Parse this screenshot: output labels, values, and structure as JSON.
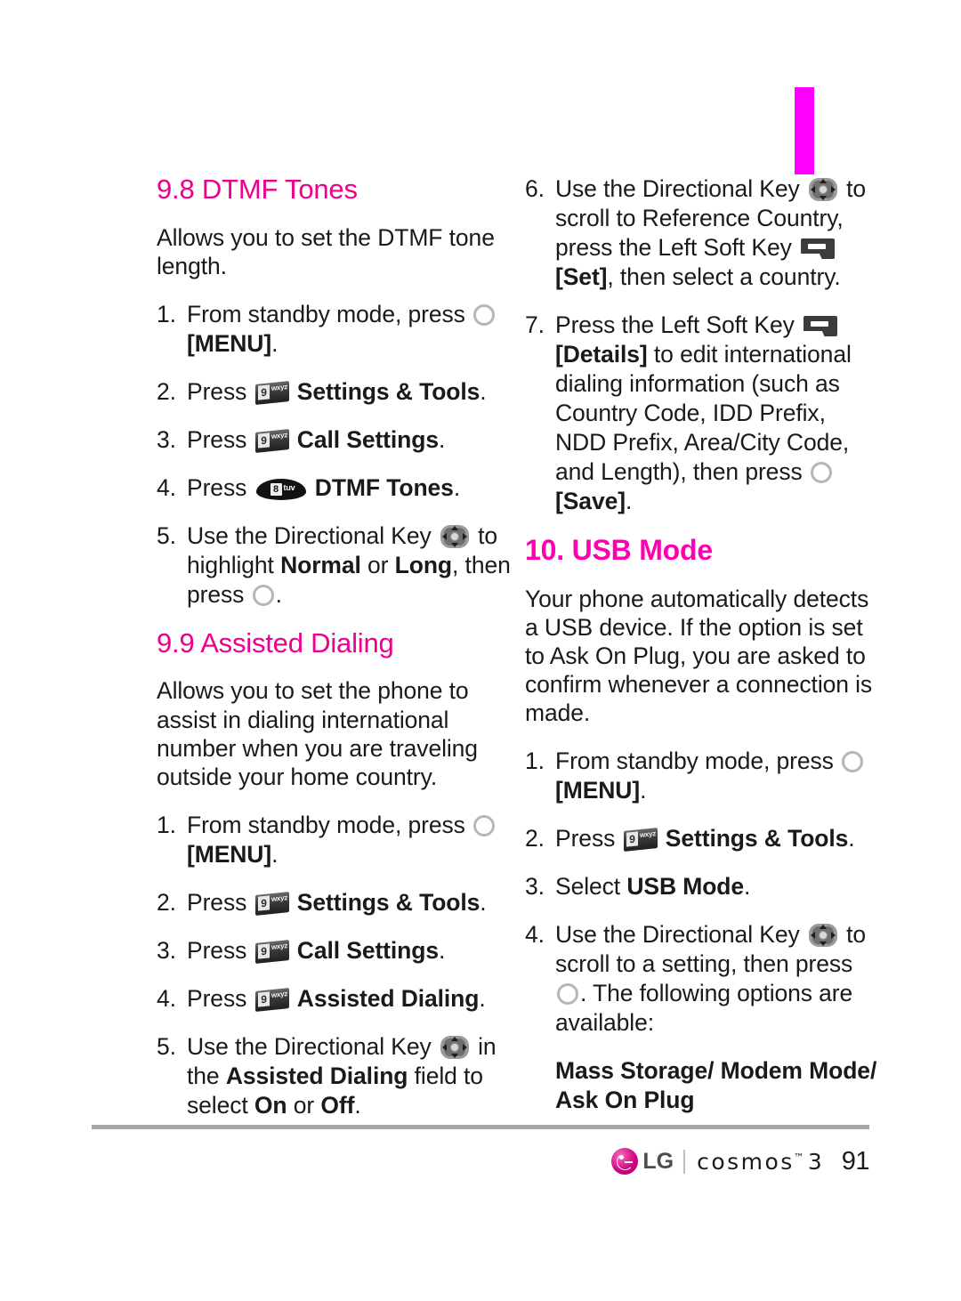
{
  "page": {
    "number": "91",
    "accent_color": "#ec008c",
    "tab_color": "#ff00ff"
  },
  "footer": {
    "brand": "LG",
    "product": "cosmos",
    "trademark": "™",
    "product_num": "3",
    "page_number": "91"
  },
  "left_column": {
    "section_1": {
      "heading": "9.8 DTMF Tones",
      "intro": "Allows you to set the DTMF tone length.",
      "steps": [
        {
          "num": "1.",
          "parts": [
            {
              "t": "text",
              "v": "From standby mode, press "
            },
            {
              "t": "icon",
              "v": "ok-button"
            },
            {
              "t": "text",
              "v": " "
            },
            {
              "t": "bold",
              "v": "[MENU]"
            },
            {
              "t": "text",
              "v": "."
            }
          ]
        },
        {
          "num": "2.",
          "parts": [
            {
              "t": "text",
              "v": "Press "
            },
            {
              "t": "icon",
              "v": "key-9-wxyz"
            },
            {
              "t": "text",
              "v": " "
            },
            {
              "t": "bold",
              "v": "Settings & Tools"
            },
            {
              "t": "text",
              "v": "."
            }
          ]
        },
        {
          "num": "3.",
          "parts": [
            {
              "t": "text",
              "v": "Press "
            },
            {
              "t": "icon",
              "v": "key-9-wxyz"
            },
            {
              "t": "text",
              "v": " "
            },
            {
              "t": "bold",
              "v": "Call Settings"
            },
            {
              "t": "text",
              "v": "."
            }
          ]
        },
        {
          "num": "4.",
          "parts": [
            {
              "t": "text",
              "v": "Press "
            },
            {
              "t": "icon",
              "v": "key-8-tuv"
            },
            {
              "t": "text",
              "v": " "
            },
            {
              "t": "bold",
              "v": "DTMF Tones"
            },
            {
              "t": "text",
              "v": "."
            }
          ]
        },
        {
          "num": "5.",
          "parts": [
            {
              "t": "text",
              "v": "Use the Directional Key "
            },
            {
              "t": "icon",
              "v": "directional-key"
            },
            {
              "t": "text",
              "v": " to highlight "
            },
            {
              "t": "bold",
              "v": "Normal"
            },
            {
              "t": "text",
              "v": " or "
            },
            {
              "t": "bold",
              "v": "Long"
            },
            {
              "t": "text",
              "v": ", then press "
            },
            {
              "t": "icon",
              "v": "ok-button"
            },
            {
              "t": "text",
              "v": "."
            }
          ]
        }
      ]
    },
    "section_2": {
      "heading": "9.9 Assisted Dialing",
      "intro": "Allows you to set the phone to assist in dialing international number when you are traveling outside your home country.",
      "steps": [
        {
          "num": "1.",
          "parts": [
            {
              "t": "text",
              "v": "From standby mode, press "
            },
            {
              "t": "icon",
              "v": "ok-button"
            },
            {
              "t": "text",
              "v": " "
            },
            {
              "t": "bold",
              "v": "[MENU]"
            },
            {
              "t": "text",
              "v": "."
            }
          ]
        },
        {
          "num": "2.",
          "parts": [
            {
              "t": "text",
              "v": "Press "
            },
            {
              "t": "icon",
              "v": "key-9-wxyz"
            },
            {
              "t": "text",
              "v": " "
            },
            {
              "t": "bold",
              "v": "Settings & Tools"
            },
            {
              "t": "text",
              "v": "."
            }
          ]
        },
        {
          "num": "3.",
          "parts": [
            {
              "t": "text",
              "v": "Press "
            },
            {
              "t": "icon",
              "v": "key-9-wxyz"
            },
            {
              "t": "text",
              "v": " "
            },
            {
              "t": "bold",
              "v": "Call Settings"
            },
            {
              "t": "text",
              "v": "."
            }
          ]
        },
        {
          "num": "4.",
          "parts": [
            {
              "t": "text",
              "v": "Press "
            },
            {
              "t": "icon",
              "v": "key-9-wxyz"
            },
            {
              "t": "text",
              "v": " "
            },
            {
              "t": "bold",
              "v": "Assisted Dialing"
            },
            {
              "t": "text",
              "v": "."
            }
          ]
        },
        {
          "num": "5.",
          "parts": [
            {
              "t": "text",
              "v": "Use the Directional Key "
            },
            {
              "t": "icon",
              "v": "directional-key"
            },
            {
              "t": "text",
              "v": " in the "
            },
            {
              "t": "bold",
              "v": "Assisted Dialing"
            },
            {
              "t": "text",
              "v": " field to select "
            },
            {
              "t": "bold",
              "v": "On"
            },
            {
              "t": "text",
              "v": " or "
            },
            {
              "t": "bold",
              "v": "Off"
            },
            {
              "t": "text",
              "v": "."
            }
          ]
        }
      ]
    }
  },
  "right_column": {
    "continued_steps": [
      {
        "num": "6.",
        "parts": [
          {
            "t": "text",
            "v": "Use the Directional Key "
          },
          {
            "t": "icon",
            "v": "directional-key"
          },
          {
            "t": "text",
            "v": " to scroll to Reference Country, press the Left Soft Key "
          },
          {
            "t": "icon",
            "v": "left-soft-key"
          },
          {
            "t": "text",
            "v": " "
          },
          {
            "t": "bold",
            "v": "[Set]"
          },
          {
            "t": "text",
            "v": ", then select a country."
          }
        ]
      },
      {
        "num": "7.",
        "parts": [
          {
            "t": "text",
            "v": "Press the Left Soft Key "
          },
          {
            "t": "icon",
            "v": "left-soft-key"
          },
          {
            "t": "text",
            "v": " "
          },
          {
            "t": "bold",
            "v": "[Details]"
          },
          {
            "t": "text",
            "v": " to edit international dialing information (such as Country Code, IDD Prefix, NDD Prefix, Area/City Code, and Length), then press "
          },
          {
            "t": "icon",
            "v": "ok-button"
          },
          {
            "t": "text",
            "v": " "
          },
          {
            "t": "bold",
            "v": "[Save]"
          },
          {
            "t": "text",
            "v": "."
          }
        ]
      }
    ],
    "section_3": {
      "heading": "10. USB Mode",
      "intro": "Your phone automatically detects a USB device. If the option is set to Ask On Plug, you are asked to confirm whenever a connection is made.",
      "steps": [
        {
          "num": "1.",
          "parts": [
            {
              "t": "text",
              "v": "From standby mode, press "
            },
            {
              "t": "icon",
              "v": "ok-button"
            },
            {
              "t": "text",
              "v": " "
            },
            {
              "t": "bold",
              "v": "[MENU]"
            },
            {
              "t": "text",
              "v": "."
            }
          ]
        },
        {
          "num": "2.",
          "parts": [
            {
              "t": "text",
              "v": "Press "
            },
            {
              "t": "icon",
              "v": "key-9-wxyz"
            },
            {
              "t": "text",
              "v": " "
            },
            {
              "t": "bold",
              "v": "Settings & Tools"
            },
            {
              "t": "text",
              "v": "."
            }
          ]
        },
        {
          "num": "3.",
          "parts": [
            {
              "t": "text",
              "v": "Select "
            },
            {
              "t": "bold",
              "v": "USB Mode"
            },
            {
              "t": "text",
              "v": "."
            }
          ]
        },
        {
          "num": "4.",
          "parts": [
            {
              "t": "text",
              "v": "Use the Directional Key "
            },
            {
              "t": "icon",
              "v": "directional-key"
            },
            {
              "t": "text",
              "v": "  to scroll to a setting, then press "
            },
            {
              "t": "icon",
              "v": "ok-button"
            },
            {
              "t": "text",
              "v": ". The following options are available:"
            }
          ]
        }
      ],
      "options": "Mass Storage/ Modem Mode/ Ask On Plug"
    }
  },
  "icons": {
    "key-9-wxyz": {
      "digit": "9",
      "letters": "wxyz"
    },
    "key-8-tuv": {
      "digit": "8",
      "letters": "tuv"
    },
    "ok-button": {
      "label": "OK"
    },
    "directional-key": {
      "label": "Directional Key"
    },
    "left-soft-key": {
      "label": "Left Soft Key"
    }
  }
}
